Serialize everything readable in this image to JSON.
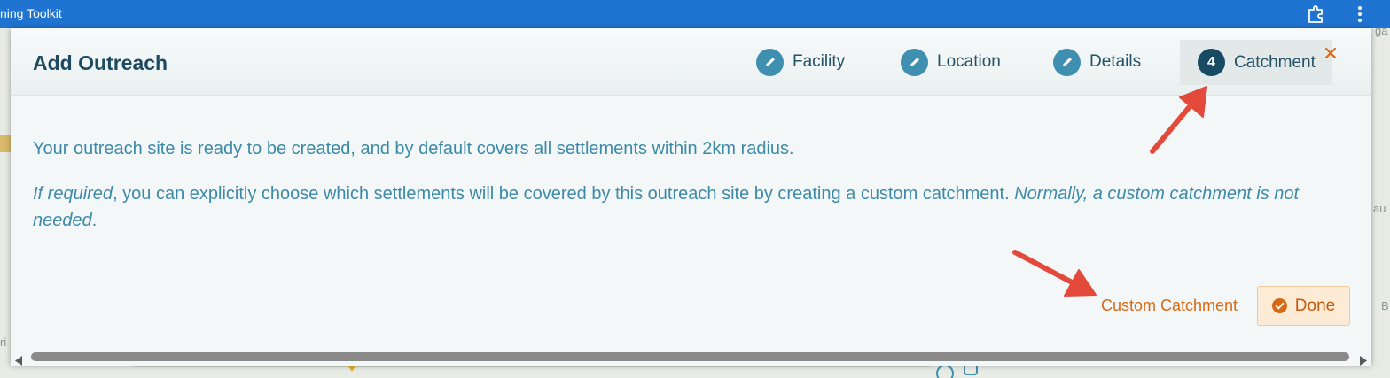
{
  "browser": {
    "title": "ning Toolkit",
    "icons": [
      "extension-icon",
      "kebab-menu-icon"
    ]
  },
  "background_map": {
    "edge_labels": [
      "ga",
      "au",
      "B",
      "ri"
    ]
  },
  "dialog": {
    "title": "Add Outreach",
    "steps": [
      {
        "label": "Facility",
        "icon": "pencil-icon",
        "state": "completed"
      },
      {
        "label": "Location",
        "icon": "pencil-icon",
        "state": "completed"
      },
      {
        "label": "Details",
        "icon": "pencil-icon",
        "state": "completed"
      },
      {
        "number": "4",
        "label": "Catchment",
        "state": "active"
      }
    ],
    "close_icon": "close-icon",
    "body": {
      "para1": "Your outreach site is ready to be created, and by default covers all settlements within 2km radius.",
      "para2_em1": "If required",
      "para2_text": ", you can explicitly choose which settlements will be covered by this outreach site by creating a custom catchment. ",
      "para2_em2": "Normally, a custom catchment is not needed",
      "para2_end": "."
    },
    "actions": {
      "custom_catchment": "Custom Catchment",
      "done": "Done"
    }
  },
  "colors": {
    "titlebar": "#1f74d1",
    "step_icon": "#3f8fb1",
    "active_step_icon": "#184a64",
    "body_text": "#3c8aa8",
    "action_orange": "#d86914",
    "done_bg": "#fdebd6",
    "annotation_arrow": "#e34a3b"
  }
}
